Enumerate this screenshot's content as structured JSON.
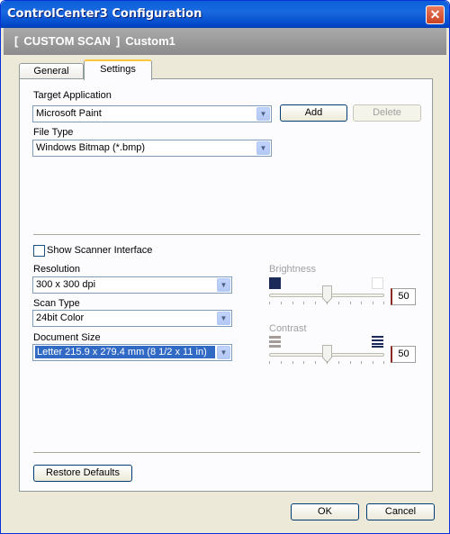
{
  "window": {
    "title": "ControlCenter3 Configuration"
  },
  "header": {
    "bracket_open": "[",
    "section": "CUSTOM SCAN",
    "bracket_close": "]",
    "name": "Custom1"
  },
  "tabs": [
    {
      "label": "General"
    },
    {
      "label": "Settings"
    }
  ],
  "target_application": {
    "label": "Target Application",
    "value": "Microsoft Paint",
    "add_label": "Add",
    "delete_label": "Delete"
  },
  "file_type": {
    "label": "File Type",
    "value": "Windows Bitmap (*.bmp)"
  },
  "show_scanner_interface": {
    "label": "Show Scanner Interface",
    "checked": false
  },
  "resolution": {
    "label": "Resolution",
    "value": "300 x 300 dpi"
  },
  "scan_type": {
    "label": "Scan Type",
    "value": "24bit Color"
  },
  "document_size": {
    "label": "Document Size",
    "value": "Letter 215.9 x 279.4 mm (8 1/2 x 11 in)"
  },
  "brightness": {
    "label": "Brightness",
    "value": "50",
    "level": 0.5
  },
  "contrast": {
    "label": "Contrast",
    "value": "50",
    "level": 0.5
  },
  "restore_defaults_label": "Restore Defaults",
  "ok_label": "OK",
  "cancel_label": "Cancel",
  "colors": {
    "title_bar": "#0a5fd8",
    "header_bar": "#9a9a9a",
    "dialog_bg": "#ece9d8",
    "selection": "#316ac5"
  }
}
